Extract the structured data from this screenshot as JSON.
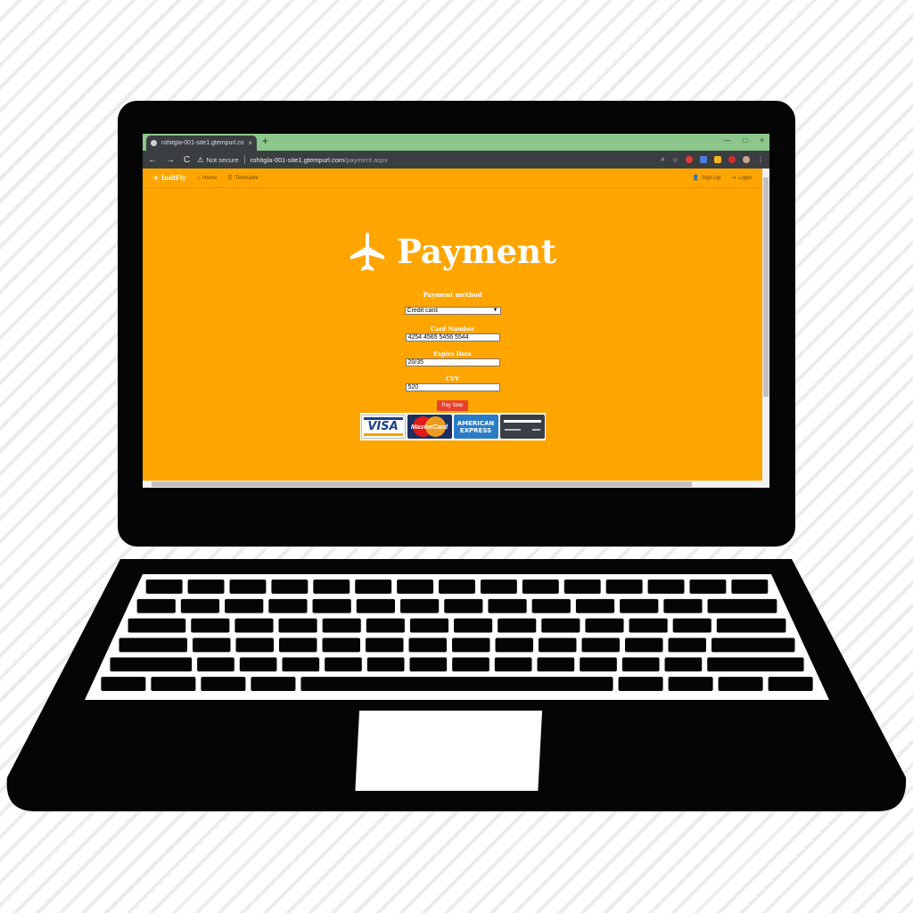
{
  "browser": {
    "tab_title": "rohitgla-001-site1.gtempurl.com",
    "tab_close": "×",
    "new_tab": "+",
    "window_controls": [
      "—",
      "□",
      "×"
    ],
    "back": "←",
    "forward": "→",
    "reload": "C",
    "security_label": "Not secure",
    "url_host": "rohitgla-001-site1.gtempurl.com",
    "url_path": "/payment.aspx"
  },
  "site_nav": {
    "brand": "IndiFly",
    "home": "Home",
    "timetable": "Timetable",
    "signup": "Sign Up",
    "login": "Login"
  },
  "page": {
    "title": "Payment",
    "payment_method_label": "Payment method",
    "payment_method_value": "Credit card",
    "card_number_label": "Card Number",
    "card_number_value": "4254 4565 5456 5544",
    "expire_label": "Expire Date",
    "expire_value": "20/35",
    "cvv_label": "CVV",
    "cvv_value": "520",
    "pay_button": "Pay Now"
  },
  "cards": {
    "visa": "VISA",
    "mastercard": "MasterCard",
    "amex_line1": "AMERICAN",
    "amex_line2": "EXPRESS"
  },
  "colors": {
    "page_bg": "#ffa500",
    "tabbar": "#8cc68a",
    "toolbar": "#3b3e40",
    "button": "#e8412c"
  }
}
